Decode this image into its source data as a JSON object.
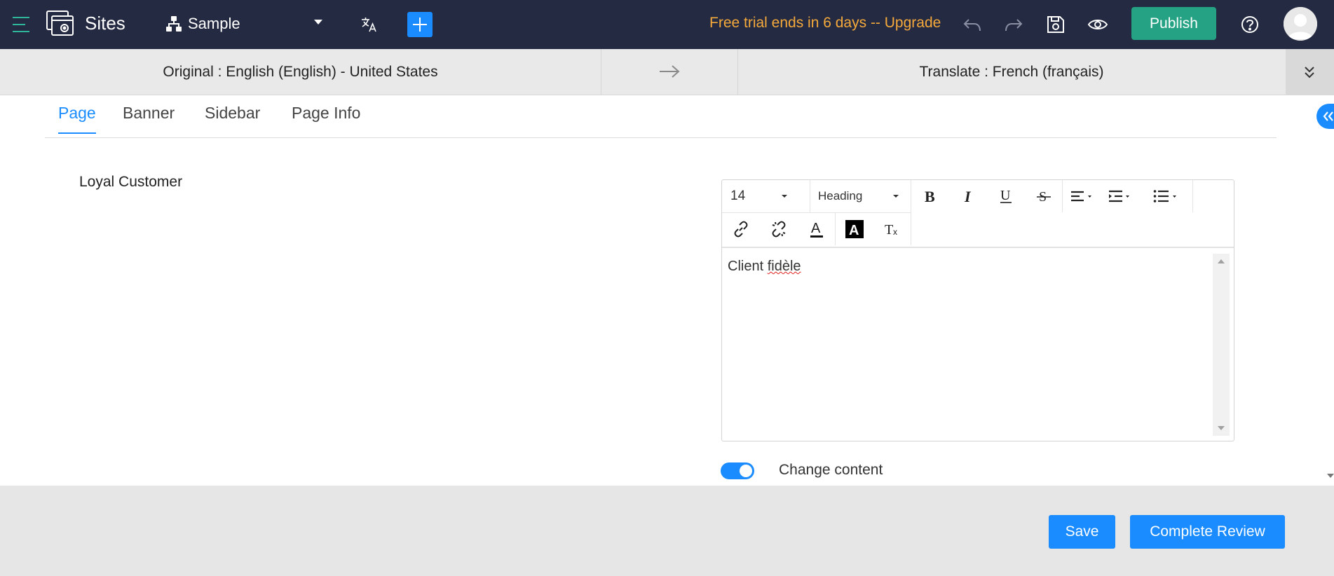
{
  "header": {
    "app_title": "Sites",
    "site_name": "Sample",
    "trial_text": "Free trial ends in 6 days -- Upgrade",
    "publish_label": "Publish",
    "icons": [
      "hamburger-icon",
      "sites-logo-icon",
      "sitemap-icon",
      "translate-icon",
      "plus-icon",
      "undo-icon",
      "redo-icon",
      "save-icon",
      "preview-eye-icon",
      "help-icon",
      "avatar-icon"
    ],
    "colors": {
      "bar": "#242a42",
      "accent": "#1a8cff",
      "publish": "#24a283",
      "trial": "#f5a93b"
    }
  },
  "language_bar": {
    "original": "Original : English (English) - United States",
    "target": "Translate : French (français)"
  },
  "tabs": [
    {
      "label": "Page",
      "active": true
    },
    {
      "label": "Banner",
      "active": false
    },
    {
      "label": "Sidebar",
      "active": false
    },
    {
      "label": "Page Info",
      "active": false
    }
  ],
  "original_content": "Loyal Customer",
  "editor": {
    "font_size": "14",
    "block_format": "Heading",
    "toolbar_icons": [
      "bold-icon",
      "italic-icon",
      "underline-icon",
      "strikethrough-icon",
      "align-icon",
      "indent-icon",
      "bullet-list-icon",
      "link-icon",
      "unlink-icon",
      "text-color-icon",
      "background-color-icon",
      "clear-format-icon"
    ],
    "content_prefix": "Client ",
    "content_misspelled": "fidèle"
  },
  "change_content": {
    "label": "Change content",
    "enabled": true
  },
  "footer": {
    "save_label": "Save",
    "complete_label": "Complete Review"
  }
}
